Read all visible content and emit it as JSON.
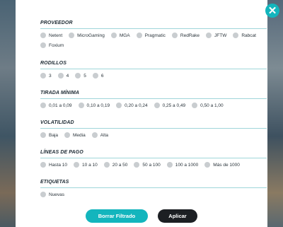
{
  "close_glyph": "✕",
  "sections": [
    {
      "title": "PROVEEDOR",
      "options": [
        "Netent",
        "MicroGaming",
        "MGA",
        "Pragmatic",
        "RedRake",
        "JFTW",
        "Rabcat",
        "Foxium"
      ]
    },
    {
      "title": "RODILLOS",
      "options": [
        "3",
        "4",
        "5",
        "6"
      ]
    },
    {
      "title": "TIRADA MÍNIMA",
      "options": [
        "0,01 a 0,09",
        "0,10 a 0,19",
        "0,20 a 0,24",
        "0,25 a 0,49",
        "0,50 a 1,00"
      ]
    },
    {
      "title": "VOLATILIDAD",
      "options": [
        "Baja",
        "Media",
        "Alta"
      ]
    },
    {
      "title": "LÍNEAS DE PAGO",
      "options": [
        "Hasta 10",
        "10 a 10",
        "20 a 50",
        "50 a 100",
        "100 a 1000",
        "Más de 1000"
      ]
    },
    {
      "title": "ETIQUETAS",
      "options": [
        "Nuevas"
      ]
    }
  ],
  "buttons": {
    "clear": "Borrar Filtrado",
    "apply": "Aplicar"
  },
  "colors": {
    "accent": "#13b5bd",
    "dark": "#1c1f23"
  }
}
